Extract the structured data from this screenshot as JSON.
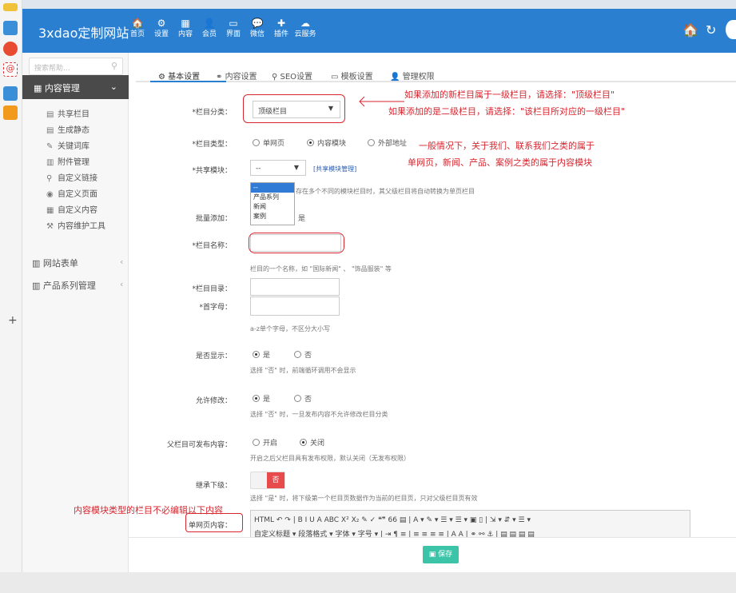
{
  "app": {
    "brand": "3xdao定制网站"
  },
  "topnav": [
    {
      "icon": "home-icon",
      "glyph": "🏠",
      "label": "首页"
    },
    {
      "icon": "gear-icon",
      "glyph": "⚙",
      "label": "设置"
    },
    {
      "icon": "grid-icon",
      "glyph": "▦",
      "label": "内容"
    },
    {
      "icon": "user-icon",
      "glyph": "👤",
      "label": "会员"
    },
    {
      "icon": "screen-icon",
      "glyph": "▭",
      "label": "界面"
    },
    {
      "icon": "wechat-icon",
      "glyph": "💬",
      "label": "微信"
    },
    {
      "icon": "plugin-icon",
      "glyph": "✚",
      "label": "插件"
    },
    {
      "icon": "cloud-icon",
      "glyph": "☁",
      "label": "云服务"
    }
  ],
  "sidebar": {
    "search_placeholder": "搜索帮助...",
    "group": "内容管理",
    "items": [
      "共享栏目",
      "生成静态",
      "关键词库",
      "附件管理",
      "自定义链接",
      "自定义页面",
      "自定义内容",
      "内容维护工具"
    ],
    "sections": [
      "网站表单",
      "产品系列管理"
    ]
  },
  "tabs": [
    "基本设置",
    "内容设置",
    "SEO设置",
    "模板设置",
    "管理权限"
  ],
  "form": {
    "category_type_label": "*栏目分类：",
    "category_type_value": "顶级栏目",
    "column_type_label": "*栏目类型：",
    "column_type_options": [
      "单网页",
      "内容模块",
      "外部地址"
    ],
    "share_module_label": "*共享模块：",
    "share_module_value": "--",
    "share_module_link": "[共享模块管理]",
    "share_module_hint": "存在多个不同的模块栏目时，其父级栏目将自动转换为单页栏目",
    "dropdown_options": [
      "--",
      "产品系列",
      "新闻",
      "案例"
    ],
    "batch_label": "批量添加：",
    "batch_value": "是",
    "name_label": "*栏目名称：",
    "name_hint": "栏目的一个名称，如 \"国际新闻\" 、 \"饰品服装\" 等",
    "dir_label": "*栏目目录：",
    "initial_label": "*首字母：",
    "initial_hint": "a-z单个字母，不区分大小写",
    "show_label": "是否显示：",
    "show_hint": "选择 \"否\" 时，前端循环调用不会显示",
    "edit_label": "允许修改：",
    "edit_hint": "选择 \"否\" 时，一旦发布内容不允许修改栏目分类",
    "yes": "是",
    "no": "否",
    "parent_publish_label": "父栏目可发布内容：",
    "open": "开启",
    "close": "关闭",
    "parent_publish_hint": "开启之后父栏目具有发布权限，默认关闭（无发布权限）",
    "inherit_label": "继承下级：",
    "inherit_toggle": "否",
    "inherit_hint": "选择 \"是\" 时，将下级第一个栏目页数据作为当前的栏目页，只对父级栏目页有效",
    "page_content_label": "单网页内容：",
    "editor_row1": "HTML  ↶ ↷ | B I U A ABC X² X₂ ✎ ✓ ❝❞ 66 ▤ | A ▾ ✎ ▾ ☰ ▾ ☰ ▾ ▣ ▯ | ⇲ ▾ ⇵ ▾ ☰ ▾",
    "editor_row2": "自定义标题 ▾  段落格式 ▾  字体     ▾  字号     ▾ | ⇥ ¶ ≡ | ≡ ≡ ≡ ≡ | A A | ⚭ ⚯ ⚓ | ▤ ▤ ▤ ▤"
  },
  "annotations": {
    "a1": "如果添加的新栏目属于一级栏目，请选择：\"顶级栏目\"",
    "a2": "如果添加的是二级栏目，请选择：\"该栏目所对应的一级栏目\"",
    "a3": "一般情况下，关于我们、联系我们之类的属于",
    "a4": "单网页，新闻、产品、案例之类的属于内容模块",
    "a5": "内容模块类型的栏目不必编辑以下内容"
  },
  "save": "保存"
}
